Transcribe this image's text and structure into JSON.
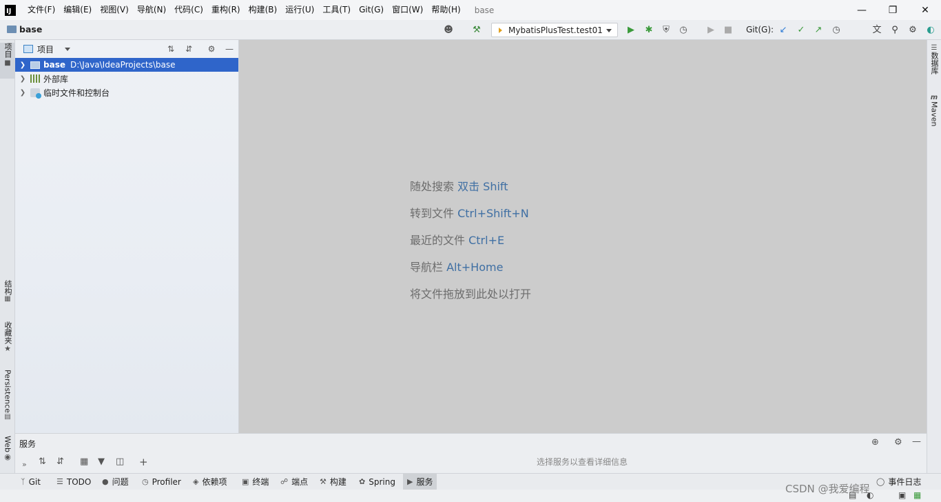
{
  "app": {
    "logo_text": "IJ",
    "window_title": "base"
  },
  "menubar": {
    "items": [
      "文件(F)",
      "编辑(E)",
      "视图(V)",
      "导航(N)",
      "代码(C)",
      "重构(R)",
      "构建(B)",
      "运行(U)",
      "工具(T)",
      "Git(G)",
      "窗口(W)",
      "帮助(H)"
    ]
  },
  "window_controls": {
    "minimize": "—",
    "restore": "❐",
    "close": "✕"
  },
  "navbar": {
    "project_name": "base",
    "run_config": "MybatisPlusTest.test01",
    "git_label": "Git(G):"
  },
  "left_stripe": {
    "project_tab": "项目",
    "structure_tab": "结构",
    "favorites_tab": "收藏夹",
    "persistence_tab": "Persistence",
    "web_tab": "Web"
  },
  "right_stripe": {
    "database_tab": "数据库",
    "maven_tab": "Maven"
  },
  "project_panel": {
    "title": "项目",
    "tree": [
      {
        "name": "base",
        "path": "D:\\Java\\IdeaProjects\\base",
        "selected": true
      },
      {
        "name": "外部库"
      },
      {
        "name": "临时文件和控制台"
      }
    ]
  },
  "editor": {
    "hints": [
      {
        "label": "随处搜索 ",
        "key": "双击 Shift"
      },
      {
        "label": "转到文件 ",
        "key": "Ctrl+Shift+N"
      },
      {
        "label": "最近的文件 ",
        "key": "Ctrl+E"
      },
      {
        "label": "导航栏 ",
        "key": "Alt+Home"
      },
      {
        "label": "将文件拖放到此处以打开",
        "key": ""
      }
    ]
  },
  "services": {
    "title": "服务",
    "empty_text": "选择服务以查看详细信息"
  },
  "bottom_tabs": [
    "Git",
    "TODO",
    "问题",
    "Profiler",
    "依赖项",
    "终端",
    "端点",
    "构建",
    "Spring",
    "服务"
  ],
  "status_bar": {
    "event_log": "事件日志"
  },
  "watermark": "CSDN @我爱编程"
}
